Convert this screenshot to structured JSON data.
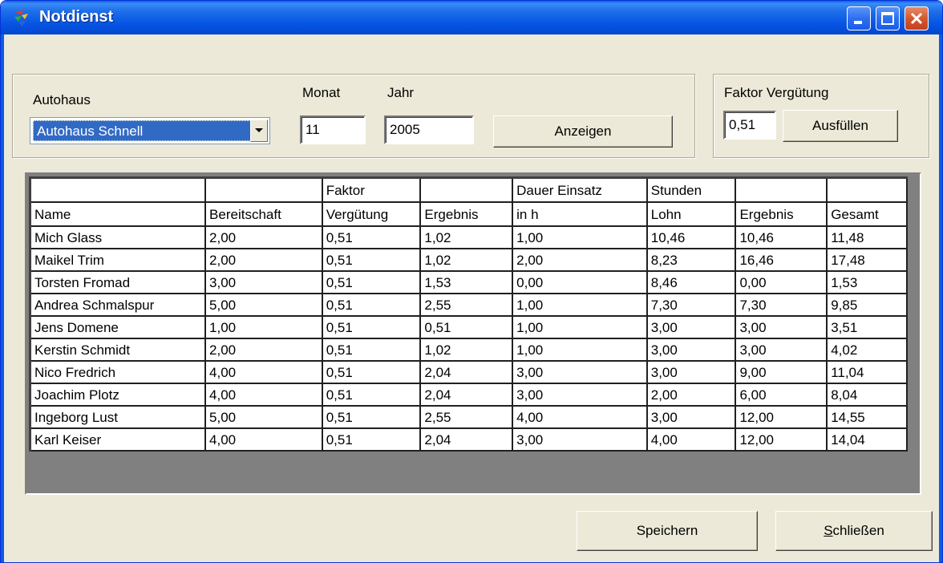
{
  "window": {
    "title": "Notdienst"
  },
  "filters": {
    "autohaus_label": "Autohaus",
    "autohaus_value": "Autohaus Schnell",
    "monat_label": "Monat",
    "monat_value": "11",
    "jahr_label": "Jahr",
    "jahr_value": "2005",
    "anzeigen_label": "Anzeigen"
  },
  "faktor": {
    "label": "Faktor Vergütung",
    "value": "0,51",
    "ausfuellen_label": "Ausfüllen"
  },
  "table": {
    "header_top": [
      "",
      "",
      "Faktor",
      "",
      "Dauer Einsatz",
      "Stunden",
      "",
      ""
    ],
    "header_bottom": [
      "Name",
      "Bereitschaft",
      "Vergütung",
      "Ergebnis",
      "in h",
      "Lohn",
      "Ergebnis",
      "Gesamt"
    ],
    "rows": [
      [
        "Mich Glass",
        "2,00",
        "0,51",
        "1,02",
        "1,00",
        "10,46",
        "10,46",
        "11,48"
      ],
      [
        "Maikel Trim",
        "2,00",
        "0,51",
        "1,02",
        "2,00",
        "8,23",
        "16,46",
        "17,48"
      ],
      [
        "Torsten Fromad",
        "3,00",
        "0,51",
        "1,53",
        "0,00",
        "8,46",
        "0,00",
        "1,53"
      ],
      [
        "Andrea Schmalspur",
        "5,00",
        "0,51",
        "2,55",
        "1,00",
        "7,30",
        "7,30",
        "9,85"
      ],
      [
        "Jens Domene",
        "1,00",
        "0,51",
        "0,51",
        "1,00",
        "3,00",
        "3,00",
        "3,51"
      ],
      [
        "Kerstin Schmidt",
        "2,00",
        "0,51",
        "1,02",
        "1,00",
        "3,00",
        "3,00",
        "4,02"
      ],
      [
        "Nico Fredrich",
        "4,00",
        "0,51",
        "2,04",
        "3,00",
        "3,00",
        "9,00",
        "11,04"
      ],
      [
        "Joachim Plotz",
        "4,00",
        "0,51",
        "2,04",
        "3,00",
        "2,00",
        "6,00",
        "8,04"
      ],
      [
        "Ingeborg Lust",
        "5,00",
        "0,51",
        "2,55",
        "4,00",
        "3,00",
        "12,00",
        "14,55"
      ],
      [
        "Karl Keiser",
        "4,00",
        "0,51",
        "2,04",
        "3,00",
        "4,00",
        "12,00",
        "14,04"
      ]
    ]
  },
  "footer": {
    "speichern_label": "Speichern",
    "schliessen_label": "Schließen"
  },
  "icons": {
    "app": "app-icon",
    "minimize": "minimize-icon",
    "maximize": "maximize-icon",
    "close": "close-icon",
    "dropdown": "chevron-down-icon"
  },
  "colors": {
    "titlebar": "#0554e3",
    "window_bg": "#ece9d8",
    "selection": "#316ac5",
    "close_button": "#c64020"
  }
}
